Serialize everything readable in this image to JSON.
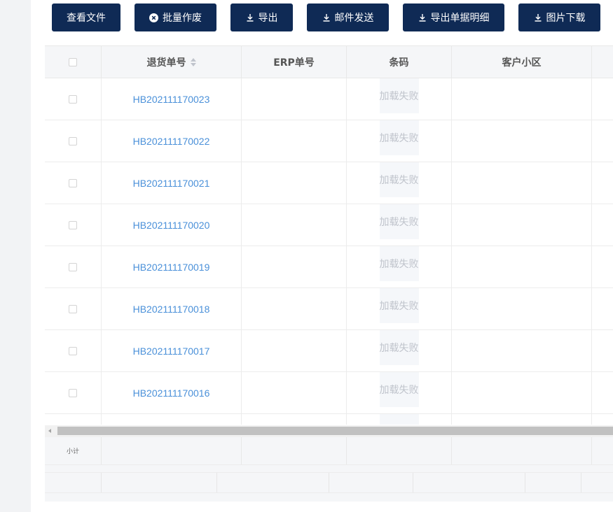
{
  "toolbar": {
    "buttons": [
      {
        "label": "查看文件",
        "icon": ""
      },
      {
        "label": "批量作废",
        "icon": "close-circle-icon"
      },
      {
        "label": "导出",
        "icon": "download-icon"
      },
      {
        "label": "邮件发送",
        "icon": "download-icon"
      },
      {
        "label": "导出单据明细",
        "icon": "download-icon"
      },
      {
        "label": "图片下载",
        "icon": "download-icon"
      }
    ],
    "button_color": "#0f2a55"
  },
  "table": {
    "columns": [
      "",
      "退货单号",
      "ERP单号",
      "条码",
      "客户小区",
      ""
    ],
    "rows": [
      {
        "order_no": "HB202111170023",
        "erp_no": "",
        "barcode_status": "加载失败",
        "community": ""
      },
      {
        "order_no": "HB202111170022",
        "erp_no": "",
        "barcode_status": "加载失败",
        "community": ""
      },
      {
        "order_no": "HB202111170021",
        "erp_no": "",
        "barcode_status": "加载失败",
        "community": ""
      },
      {
        "order_no": "HB202111170020",
        "erp_no": "",
        "barcode_status": "加载失败",
        "community": ""
      },
      {
        "order_no": "HB202111170019",
        "erp_no": "",
        "barcode_status": "加载失败",
        "community": ""
      },
      {
        "order_no": "HB202111170018",
        "erp_no": "",
        "barcode_status": "加载失败",
        "community": ""
      },
      {
        "order_no": "HB202111170017",
        "erp_no": "",
        "barcode_status": "加载失败",
        "community": ""
      },
      {
        "order_no": "HB202111170016",
        "erp_no": "",
        "barcode_status": "加载失败",
        "community": ""
      }
    ],
    "summary_label": "小计",
    "link_color": "#4a90d9"
  }
}
